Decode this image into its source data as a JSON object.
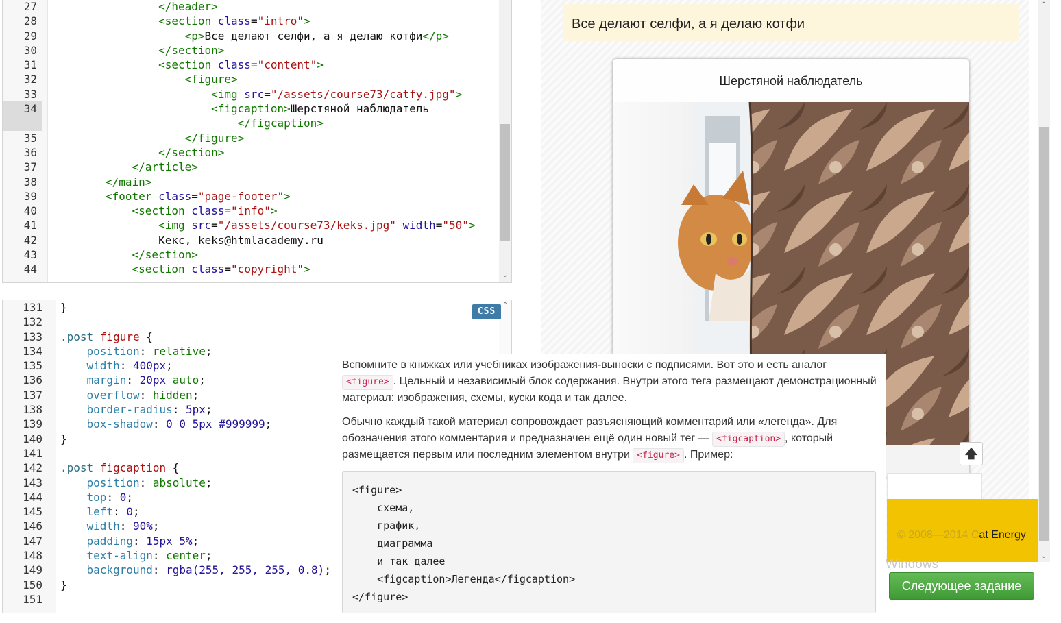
{
  "html_editor": {
    "lines": [
      {
        "n": "27",
        "segs": [
          [
            "        ",
            "tok-text"
          ],
          [
            "</header>",
            "tok-tag"
          ]
        ]
      },
      {
        "n": "28",
        "segs": [
          [
            "        ",
            "tok-text"
          ],
          [
            "<section ",
            "tok-tag"
          ],
          [
            "class",
            "tok-attr"
          ],
          [
            "=",
            "tok-text"
          ],
          [
            "\"intro\"",
            "tok-str"
          ],
          [
            ">",
            "tok-tag"
          ]
        ]
      },
      {
        "n": "29",
        "segs": [
          [
            "            ",
            "tok-text"
          ],
          [
            "<p>",
            "tok-tag"
          ],
          [
            "Все делают селфи, а я делаю котфи",
            "tok-text"
          ],
          [
            "</p>",
            "tok-tag"
          ]
        ]
      },
      {
        "n": "30",
        "segs": [
          [
            "        ",
            "tok-text"
          ],
          [
            "</section>",
            "tok-tag"
          ]
        ]
      },
      {
        "n": "31",
        "segs": [
          [
            "        ",
            "tok-text"
          ],
          [
            "<section ",
            "tok-tag"
          ],
          [
            "class",
            "tok-attr"
          ],
          [
            "=",
            "tok-text"
          ],
          [
            "\"content\"",
            "tok-str"
          ],
          [
            ">",
            "tok-tag"
          ]
        ]
      },
      {
        "n": "32",
        "segs": [
          [
            "            ",
            "tok-text"
          ],
          [
            "<figure>",
            "tok-tag"
          ]
        ]
      },
      {
        "n": "33",
        "segs": [
          [
            "                ",
            "tok-text"
          ],
          [
            "<img ",
            "tok-tag"
          ],
          [
            "src",
            "tok-attr"
          ],
          [
            "=",
            "tok-text"
          ],
          [
            "\"/assets/course73/catfy.jpg\"",
            "tok-str"
          ],
          [
            ">",
            "tok-tag"
          ]
        ]
      },
      {
        "n": "34",
        "active": true,
        "segs": [
          [
            "                ",
            "tok-text"
          ],
          [
            "<figcaption>",
            "tok-tag"
          ],
          [
            "Шерстяной наблюдатель",
            "tok-text"
          ]
        ],
        "segs2": [
          [
            "                    ",
            "tok-text"
          ],
          [
            "</figcaption>",
            "tok-tag"
          ]
        ]
      },
      {
        "n": "35",
        "segs": [
          [
            "            ",
            "tok-text"
          ],
          [
            "</figure>",
            "tok-tag"
          ]
        ]
      },
      {
        "n": "36",
        "segs": [
          [
            "        ",
            "tok-text"
          ],
          [
            "</section>",
            "tok-tag"
          ]
        ]
      },
      {
        "n": "37",
        "segs": [
          [
            "    ",
            "tok-text"
          ],
          [
            "</article>",
            "tok-tag"
          ]
        ]
      },
      {
        "n": "38",
        "segs": [
          [
            "",
            "tok-text"
          ],
          [
            "</main>",
            "tok-tag"
          ]
        ]
      },
      {
        "n": "39",
        "segs": [
          [
            "",
            "tok-text"
          ],
          [
            "<footer ",
            "tok-tag"
          ],
          [
            "class",
            "tok-attr"
          ],
          [
            "=",
            "tok-text"
          ],
          [
            "\"page-footer\"",
            "tok-str"
          ],
          [
            ">",
            "tok-tag"
          ]
        ]
      },
      {
        "n": "40",
        "segs": [
          [
            "    ",
            "tok-text"
          ],
          [
            "<section ",
            "tok-tag"
          ],
          [
            "class",
            "tok-attr"
          ],
          [
            "=",
            "tok-text"
          ],
          [
            "\"info\"",
            "tok-str"
          ],
          [
            ">",
            "tok-tag"
          ]
        ]
      },
      {
        "n": "41",
        "segs": [
          [
            "        ",
            "tok-text"
          ],
          [
            "<img ",
            "tok-tag"
          ],
          [
            "src",
            "tok-attr"
          ],
          [
            "=",
            "tok-text"
          ],
          [
            "\"/assets/course73/keks.jpg\"",
            "tok-str"
          ],
          [
            " ",
            "tok-text"
          ],
          [
            "width",
            "tok-attr"
          ],
          [
            "=",
            "tok-text"
          ],
          [
            "\"50\"",
            "tok-str"
          ],
          [
            ">",
            "tok-tag"
          ]
        ]
      },
      {
        "n": "42",
        "segs": [
          [
            "        ",
            "tok-text"
          ],
          [
            "Кекс, keks@htmlacademy.ru",
            "tok-text"
          ]
        ]
      },
      {
        "n": "43",
        "segs": [
          [
            "    ",
            "tok-text"
          ],
          [
            "</section>",
            "tok-tag"
          ]
        ]
      },
      {
        "n": "44",
        "segs": [
          [
            "    ",
            "tok-text"
          ],
          [
            "<section ",
            "tok-tag"
          ],
          [
            "class",
            "tok-attr"
          ],
          [
            "=",
            "tok-text"
          ],
          [
            "\"copyright\"",
            "tok-str"
          ],
          [
            ">",
            "tok-tag"
          ]
        ]
      }
    ]
  },
  "css_editor": {
    "badge": "CSS",
    "lines": [
      {
        "n": "131",
        "segs": [
          [
            "}",
            "tok-punct"
          ]
        ]
      },
      {
        "n": "132",
        "segs": [
          [
            "",
            "tok-text"
          ]
        ]
      },
      {
        "n": "133",
        "segs": [
          [
            ".post ",
            "tok-sel"
          ],
          [
            "figure",
            "tok-sel-tag"
          ],
          [
            " {",
            "tok-punct"
          ]
        ]
      },
      {
        "n": "134",
        "segs": [
          [
            "    ",
            "tok-text"
          ],
          [
            "position",
            "tok-prop"
          ],
          [
            ": ",
            "tok-punct"
          ],
          [
            "relative",
            "tok-val"
          ],
          [
            ";",
            "tok-punct"
          ]
        ]
      },
      {
        "n": "135",
        "segs": [
          [
            "    ",
            "tok-text"
          ],
          [
            "width",
            "tok-prop"
          ],
          [
            ": ",
            "tok-punct"
          ],
          [
            "400px",
            "tok-kw"
          ],
          [
            ";",
            "tok-punct"
          ]
        ]
      },
      {
        "n": "136",
        "segs": [
          [
            "    ",
            "tok-text"
          ],
          [
            "margin",
            "tok-prop"
          ],
          [
            ": ",
            "tok-punct"
          ],
          [
            "20px",
            "tok-kw"
          ],
          [
            " ",
            "tok-text"
          ],
          [
            "auto",
            "tok-val"
          ],
          [
            ";",
            "tok-punct"
          ]
        ]
      },
      {
        "n": "137",
        "segs": [
          [
            "    ",
            "tok-text"
          ],
          [
            "overflow",
            "tok-prop"
          ],
          [
            ": ",
            "tok-punct"
          ],
          [
            "hidden",
            "tok-val"
          ],
          [
            ";",
            "tok-punct"
          ]
        ]
      },
      {
        "n": "138",
        "segs": [
          [
            "    ",
            "tok-text"
          ],
          [
            "border-radius",
            "tok-prop"
          ],
          [
            ": ",
            "tok-punct"
          ],
          [
            "5px",
            "tok-kw"
          ],
          [
            ";",
            "tok-punct"
          ]
        ]
      },
      {
        "n": "139",
        "segs": [
          [
            "    ",
            "tok-text"
          ],
          [
            "box-shadow",
            "tok-prop"
          ],
          [
            ": ",
            "tok-punct"
          ],
          [
            "0 0 5px #999999",
            "tok-kw"
          ],
          [
            ";",
            "tok-punct"
          ]
        ]
      },
      {
        "n": "140",
        "segs": [
          [
            "}",
            "tok-punct"
          ]
        ]
      },
      {
        "n": "141",
        "segs": [
          [
            "",
            "tok-text"
          ]
        ]
      },
      {
        "n": "142",
        "segs": [
          [
            ".post ",
            "tok-sel"
          ],
          [
            "figcaption",
            "tok-sel-tag"
          ],
          [
            " {",
            "tok-punct"
          ]
        ]
      },
      {
        "n": "143",
        "segs": [
          [
            "    ",
            "tok-text"
          ],
          [
            "position",
            "tok-prop"
          ],
          [
            ": ",
            "tok-punct"
          ],
          [
            "absolute",
            "tok-val"
          ],
          [
            ";",
            "tok-punct"
          ]
        ]
      },
      {
        "n": "144",
        "segs": [
          [
            "    ",
            "tok-text"
          ],
          [
            "top",
            "tok-prop"
          ],
          [
            ": ",
            "tok-punct"
          ],
          [
            "0",
            "tok-kw"
          ],
          [
            ";",
            "tok-punct"
          ]
        ]
      },
      {
        "n": "145",
        "segs": [
          [
            "    ",
            "tok-text"
          ],
          [
            "left",
            "tok-prop"
          ],
          [
            ": ",
            "tok-punct"
          ],
          [
            "0",
            "tok-kw"
          ],
          [
            ";",
            "tok-punct"
          ]
        ]
      },
      {
        "n": "146",
        "segs": [
          [
            "    ",
            "tok-text"
          ],
          [
            "width",
            "tok-prop"
          ],
          [
            ": ",
            "tok-punct"
          ],
          [
            "90%",
            "tok-kw"
          ],
          [
            ";",
            "tok-punct"
          ]
        ]
      },
      {
        "n": "147",
        "segs": [
          [
            "    ",
            "tok-text"
          ],
          [
            "padding",
            "tok-prop"
          ],
          [
            ": ",
            "tok-punct"
          ],
          [
            "15px 5%",
            "tok-kw"
          ],
          [
            ";",
            "tok-punct"
          ]
        ]
      },
      {
        "n": "148",
        "segs": [
          [
            "    ",
            "tok-text"
          ],
          [
            "text-align",
            "tok-prop"
          ],
          [
            ": ",
            "tok-punct"
          ],
          [
            "center",
            "tok-val"
          ],
          [
            ";",
            "tok-punct"
          ]
        ]
      },
      {
        "n": "149",
        "segs": [
          [
            "    ",
            "tok-text"
          ],
          [
            "background",
            "tok-prop"
          ],
          [
            ": ",
            "tok-punct"
          ],
          [
            "rgba(255, 255, 255, 0.8)",
            "tok-kw"
          ],
          [
            ";",
            "tok-punct"
          ]
        ]
      },
      {
        "n": "150",
        "segs": [
          [
            "}",
            "tok-punct"
          ]
        ]
      },
      {
        "n": "151",
        "segs": [
          [
            "",
            "tok-text"
          ]
        ]
      }
    ]
  },
  "preview": {
    "intro_text": "Все делают селфи, а я делаю котфи",
    "figcaption": "Шерстяной наблюдатель",
    "copyright_faded": "© 2008—2014 C",
    "copyright_visible": "at Energy",
    "up_button": "🡅",
    "watermark": "Windows"
  },
  "popup": {
    "p1_a": "Вспомните в книжках или учебниках изображения-выноски с подписями. Вот это и есть аналог ",
    "p1_code": "<figure>",
    "p1_b": ". Цельный и независимый блок содержания. Внутри этого тега размещают демонстрационный материал: изображения, схемы, куски кода и так далее.",
    "p2_a": "Обычно каждый такой материал сопровождает разъясняющий комментарий или «легенда». Для обозначения этого комментария и предназначен ещё один новый тег — ",
    "p2_code1": "<figcaption>",
    "p2_b": ", который размещается первым или последним элементом внутри ",
    "p2_code2": "<figure>",
    "p2_c": ". Пример:",
    "code_example": "<figure>\n    схема,\n    график,\n    диаграмма\n    и так далее\n    <figcaption>Легенда</figcaption>\n</figure>"
  },
  "next_button": "Следующее задание"
}
